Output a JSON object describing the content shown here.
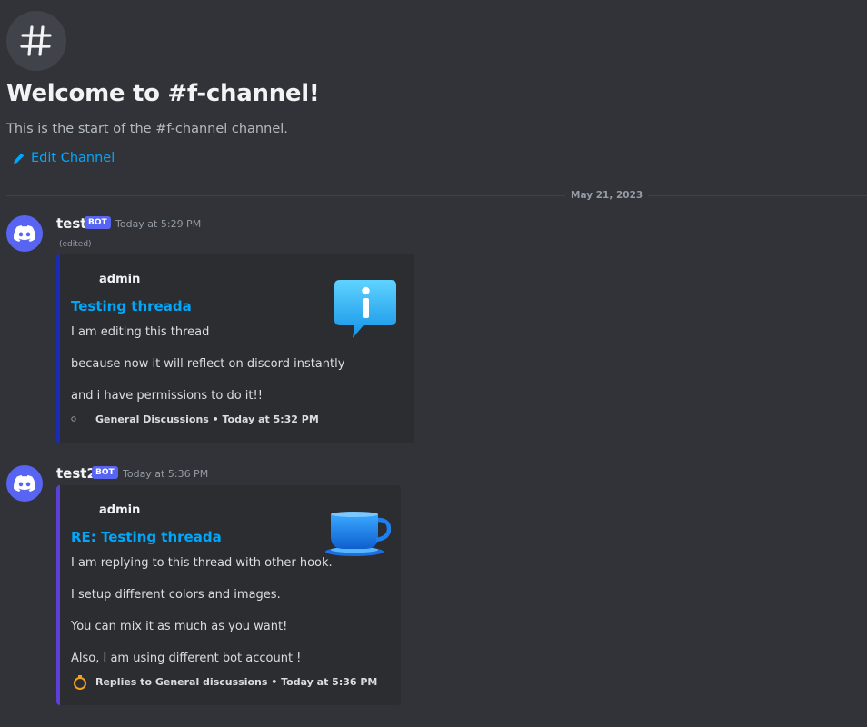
{
  "channel": {
    "welcome_title": "Welcome to #f-channel!",
    "start_text": "This is the start of the #f-channel channel.",
    "edit_label": "Edit Channel"
  },
  "date_divider": "May 21, 2023",
  "messages": [
    {
      "username": "test",
      "bot_tag": "BOT",
      "timestamp": "Today at 5:29 PM",
      "edited": "(edited)",
      "embed": {
        "author": "admin",
        "title": "Testing threada",
        "lines": [
          "I am editing this thread",
          "because now it will reflect on discord instantly",
          "and i have permissions to do it!!"
        ],
        "footer": "General Discussions • Today at 5:32 PM",
        "color": "#1a2bb5",
        "thumbnail_icon": "info-speech-bubble-icon"
      }
    },
    {
      "username": "test2",
      "bot_tag": "BOT",
      "timestamp": "Today at 5:36 PM",
      "embed": {
        "author": "admin",
        "title": "RE: Testing threada",
        "lines": [
          "I am replying to this thread with other hook.",
          "I setup different colors and images.",
          "You can mix it as much as you want!",
          "Also, I am using different bot account !"
        ],
        "footer": "Replies to General discussions • Today at 5:36 PM",
        "color": "#5b3fd6",
        "thumbnail_icon": "coffee-cup-icon"
      }
    }
  ],
  "colors": {
    "background": "#313338",
    "embed_background": "#2b2d31",
    "link": "#00a8fc",
    "blurple": "#5865f2",
    "new_messages_divider": "#f23f43"
  }
}
